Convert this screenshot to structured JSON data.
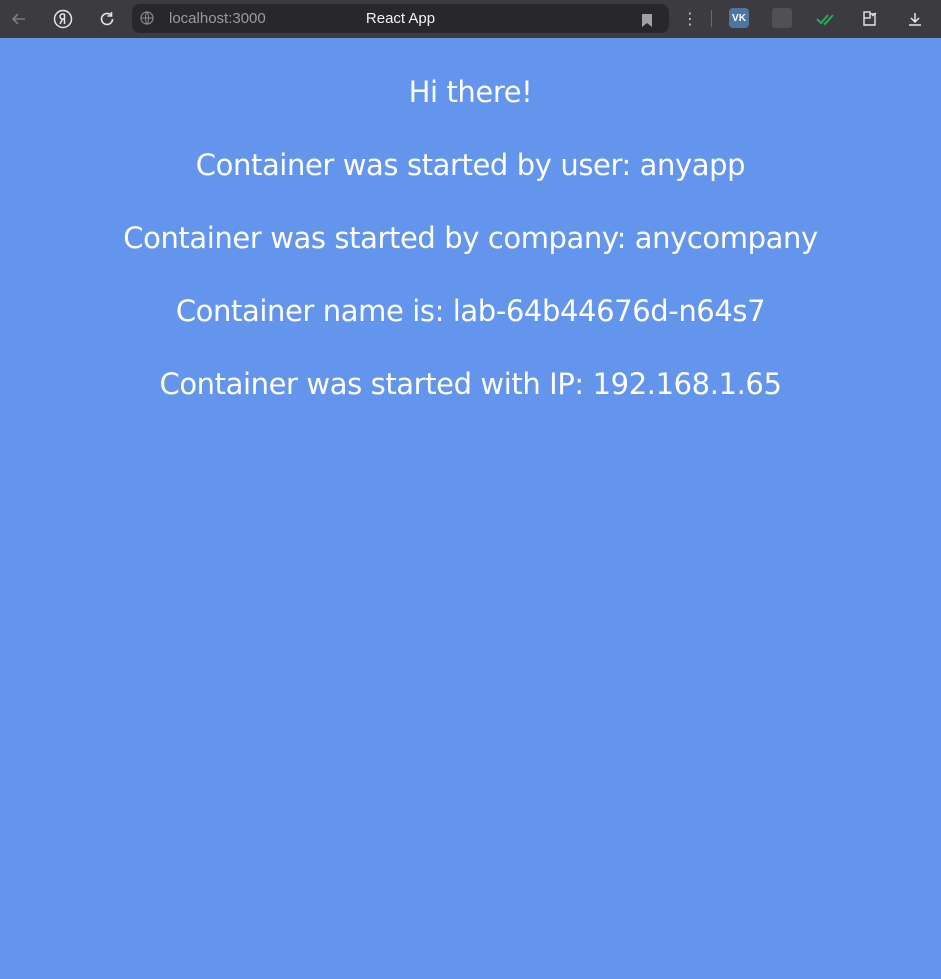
{
  "browser": {
    "address_url": "localhost:3000",
    "tab_title": "React App",
    "icons": {
      "back": "arrow-left-icon",
      "yandex": "yandex-logo-icon",
      "reload": "reload-icon",
      "site_info": "globe-icon",
      "bookmark": "bookmark-icon",
      "menu": "vertical-dots-icon",
      "ext_vk": "vk-icon",
      "ext_gray": "extension-icon",
      "ext_check": "double-check-icon",
      "ext_puzzle": "extensions-puzzle-icon",
      "download": "download-icon"
    },
    "vk_label": "VK"
  },
  "page": {
    "background_color": "#6495ed",
    "text_color": "#ffffff",
    "greeting": "Hi there!",
    "user_line": "Container was started by user: anyapp",
    "company_line": "Container was started by company: anycompany",
    "name_line": "Container name is: lab-64b44676d-n64s7",
    "ip_line": "Container was started with IP: 192.168.1.65"
  }
}
